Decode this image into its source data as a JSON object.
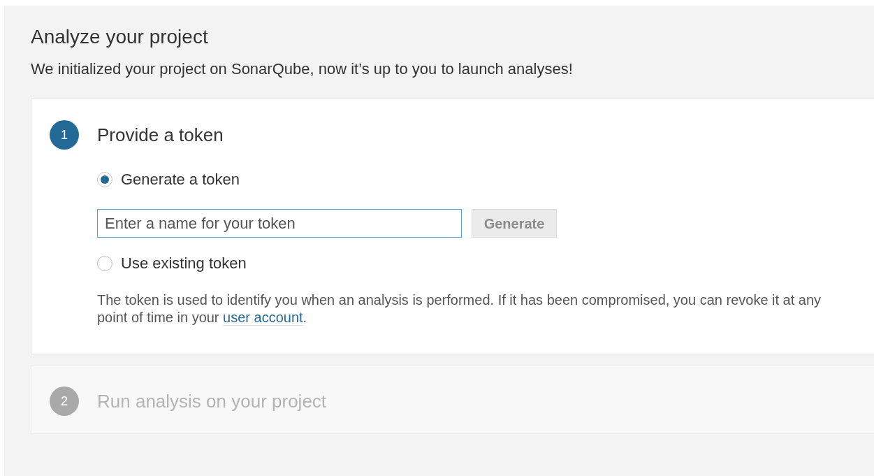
{
  "page": {
    "title": "Analyze your project",
    "subtitle": "We initialized your project on SonarQube, now it’s up to you to launch analyses!"
  },
  "steps": [
    {
      "number": "1",
      "title": "Provide a token",
      "active": true,
      "options": [
        {
          "label": "Generate a token",
          "selected": true
        },
        {
          "label": "Use existing token",
          "selected": false
        }
      ],
      "token_field": {
        "placeholder": "Enter a name for your token",
        "focused": true
      },
      "generate_button": {
        "label": "Generate",
        "disabled": true
      },
      "help": {
        "text": "The token is used to identify you when an analysis is performed. If it has been compromised, you can revoke it at any point of time in your",
        "link": "user account",
        "after": "."
      }
    },
    {
      "number": "2",
      "title": "Run analysis on your project",
      "active": false
    }
  ]
}
